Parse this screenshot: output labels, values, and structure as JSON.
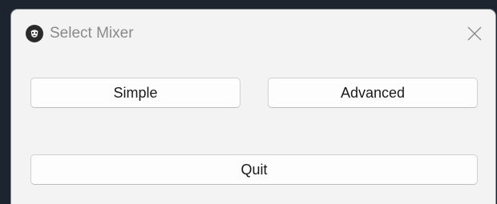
{
  "window": {
    "title": "Select Mixer",
    "icon": "lion-head-icon",
    "close_icon": "close-icon"
  },
  "buttons": {
    "simple": "Simple",
    "advanced": "Advanced",
    "quit": "Quit"
  },
  "colors": {
    "desktop_background": "#1c2430",
    "window_background": "#f3f3f3",
    "button_background": "#fdfdfd",
    "title_text": "#8a8a8a"
  }
}
